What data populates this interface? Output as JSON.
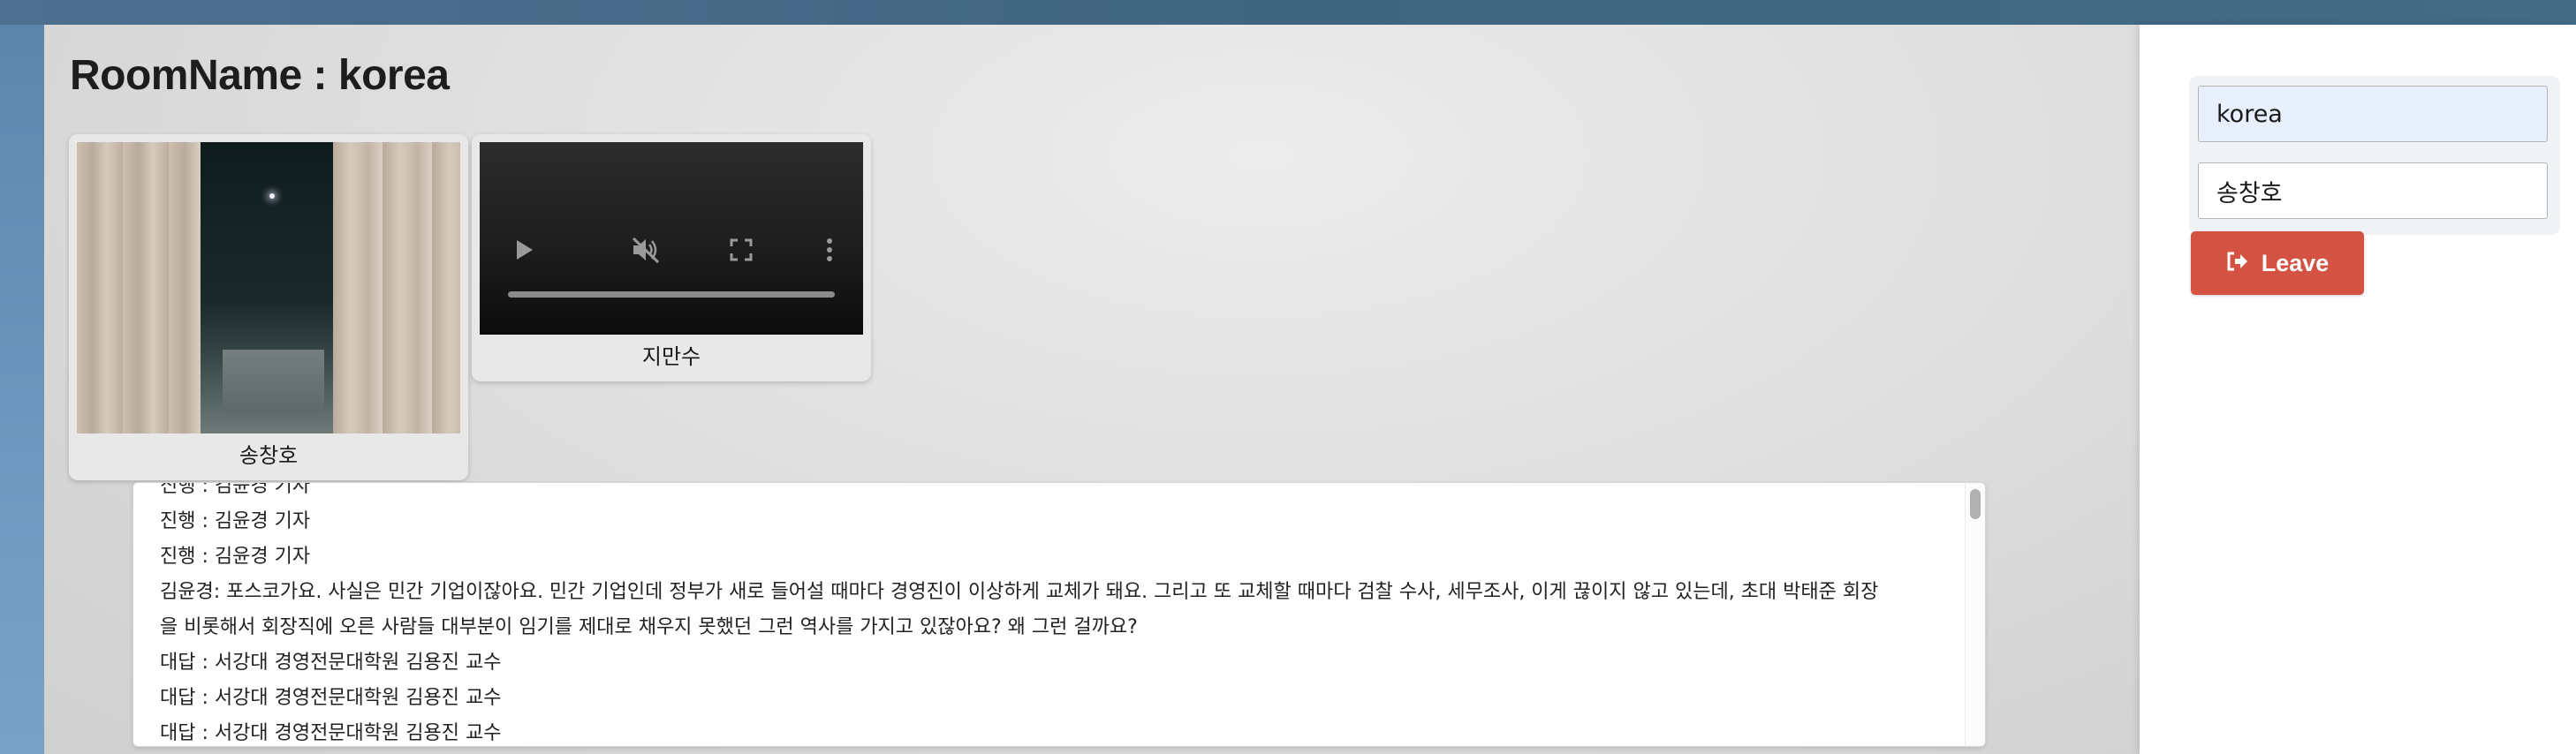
{
  "room": {
    "title": "RoomName : korea"
  },
  "participants": [
    {
      "name": "송창호"
    },
    {
      "name": "지만수"
    }
  ],
  "icons": {
    "play": "play-icon",
    "mute": "volume-muted-icon",
    "fullscreen": "fullscreen-icon",
    "more": "more-vertical-icon",
    "leave": "sign-out-icon"
  },
  "chat": {
    "lines": [
      "진행 : 김윤경 기자",
      "진행 : 김윤경 기자",
      "진행 : 김윤경 기자",
      "김윤경: 포스코가요. 사실은 민간 기업이잖아요. 민간 기업인데 정부가 새로 들어설 때마다 경영진이 이상하게 교체가 돼요. 그리고 또 교체할 때마다 검찰 수사, 세무조사, 이게 끊이지 않고 있는데, 초대 박태준 회장",
      "을 비롯해서 회장직에 오른 사람들 대부분이 임기를 제대로 채우지 못했던 그런 역사를 가지고 있잖아요? 왜 그런 걸까요?",
      "대답 : 서강대 경영전문대학원 김용진 교수",
      "대답 : 서강대 경영전문대학원 김용진 교수",
      "대답 : 서강대 경영전문대학원 김용진 교수"
    ]
  },
  "form": {
    "room_value": "korea",
    "name_value": "송창호",
    "leave_label": "Leave"
  },
  "colors": {
    "leave_button": "#d35242",
    "room_input_bg": "#e8f0fe"
  }
}
